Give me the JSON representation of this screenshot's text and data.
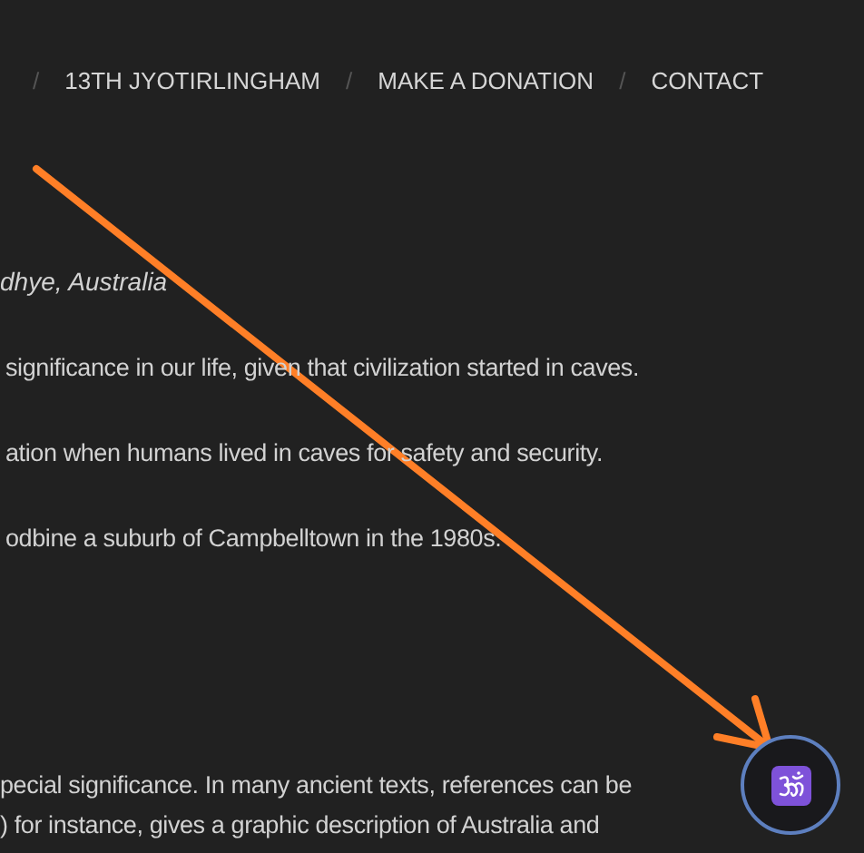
{
  "nav": [
    {
      "kind": "separator",
      "text": "/"
    },
    {
      "kind": "link",
      "text": "13TH JYOTIRLINGHAM"
    },
    {
      "kind": "separator",
      "text": "/"
    },
    {
      "kind": "link",
      "text": "MAKE A DONATION"
    },
    {
      "kind": "separator",
      "text": "/"
    },
    {
      "kind": "link",
      "text": "CONTACT"
    }
  ],
  "byline": "dhye, Australia",
  "paragraphs": [
    "significance in our life, given that civilization started in caves.",
    "ation when humans lived in caves for safety and security.",
    "odbine a suburb of Campbelltown in the 1980s."
  ],
  "lower_paragraphs": [
    "pecial significance. In many ancient texts, references can be",
    ") for instance, gives a graphic description of Australia and"
  ]
}
